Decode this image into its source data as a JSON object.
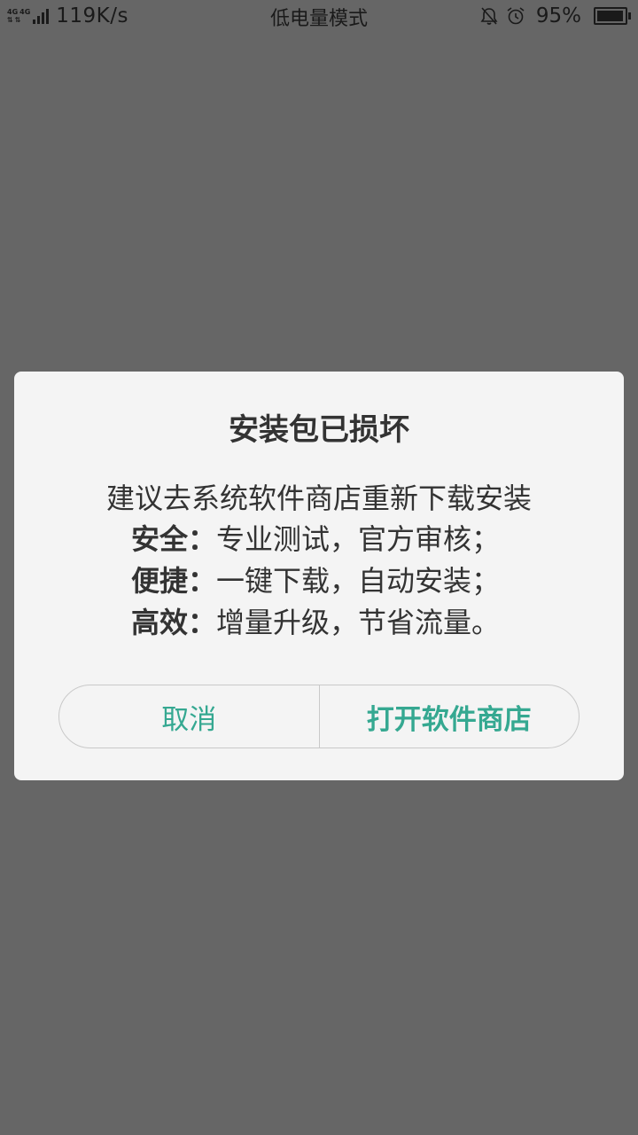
{
  "status_bar": {
    "network_1": "4G",
    "network_2": "4G",
    "speed": "119K/s",
    "mode": "低电量模式",
    "battery": "95%",
    "battery_level": 0.95,
    "icons": [
      "signal-icon",
      "bell-muted-icon",
      "alarm-icon",
      "battery-icon"
    ]
  },
  "dialog": {
    "title": "安装包已损坏",
    "message": "建议去系统软件商店重新下载安装",
    "features": [
      {
        "label": "安全：",
        "text": "专业测试，官方审核；"
      },
      {
        "label": "便捷：",
        "text": "一键下载，自动安装；"
      },
      {
        "label": "高效：",
        "text": "增量升级，节省流量。"
      }
    ],
    "cancel_label": "取消",
    "confirm_label": "打开软件商店"
  },
  "colors": {
    "accent": "#35a891",
    "overlay": "#666666",
    "dialog_bg": "#f4f4f4",
    "text": "#333333"
  }
}
